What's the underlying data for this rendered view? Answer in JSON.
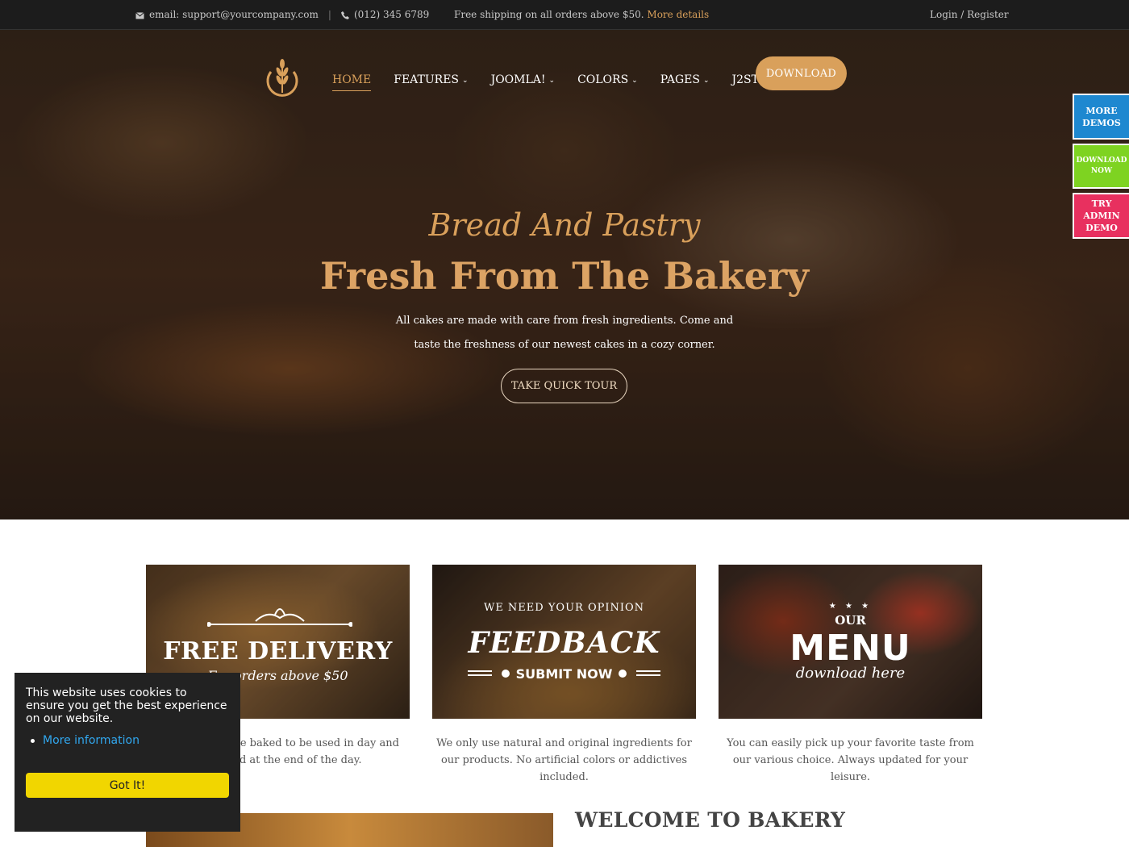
{
  "topbar": {
    "email": "email: support@yourcompany.com",
    "phone": "(012) 345 6789",
    "shipping": "Free shipping on all orders above $50.",
    "more": "More details",
    "login": "Login",
    "slash": " / ",
    "register": "Register"
  },
  "nav": {
    "items": [
      {
        "label": "HOME",
        "active": true
      },
      {
        "label": "FEATURES"
      },
      {
        "label": "JOOMLA!"
      },
      {
        "label": "COLORS"
      },
      {
        "label": "PAGES"
      },
      {
        "label": "J2STORE"
      }
    ],
    "download": "DOWNLOAD"
  },
  "side": {
    "more_demos": "MORE DEMOS",
    "download_now": "DOWNLOAD NOW",
    "try_admin": "TRY ADMIN DEMO"
  },
  "hero": {
    "script": "Bread And Pastry",
    "title": "Fresh From The Bakery",
    "subtitle": "All cakes are made with care from fresh ingredients. Come and taste the freshness of our newest cakes in a cozy corner.",
    "button": "TAKE QUICK TOUR"
  },
  "cards": [
    {
      "big": "FREE DELIVERY",
      "small": "For orders above $50",
      "text": "All our cakes are baked to be used in day and discarded at the end of the day."
    },
    {
      "arc": "WE NEED YOUR OPINION",
      "big": "FEEDBACK",
      "small": "SUBMIT NOW",
      "text": "We only use natural and original ingredients for our products. No artificial colors or addictives included."
    },
    {
      "stars": "★ ★ ★",
      "our": "OUR",
      "big": "MENU",
      "small": "download here",
      "text": "You can easily pick up your favorite taste from our various choice. Always updated for your leisure."
    }
  ],
  "welcome": {
    "title": "WELCOME TO BAKERY"
  },
  "cookie": {
    "message": "This website uses cookies to ensure you get the best experience on our website.",
    "more": "More information",
    "button": "Got It!"
  },
  "colors": {
    "accent": "#d9a05b",
    "topbar": "#1c1c1c",
    "more_demos": "#1e88d0",
    "download_now": "#7ed321",
    "try_admin": "#e8305f",
    "cookie_bg": "#222222",
    "cookie_button": "#f1d600",
    "cookie_link": "#31a8f0"
  }
}
